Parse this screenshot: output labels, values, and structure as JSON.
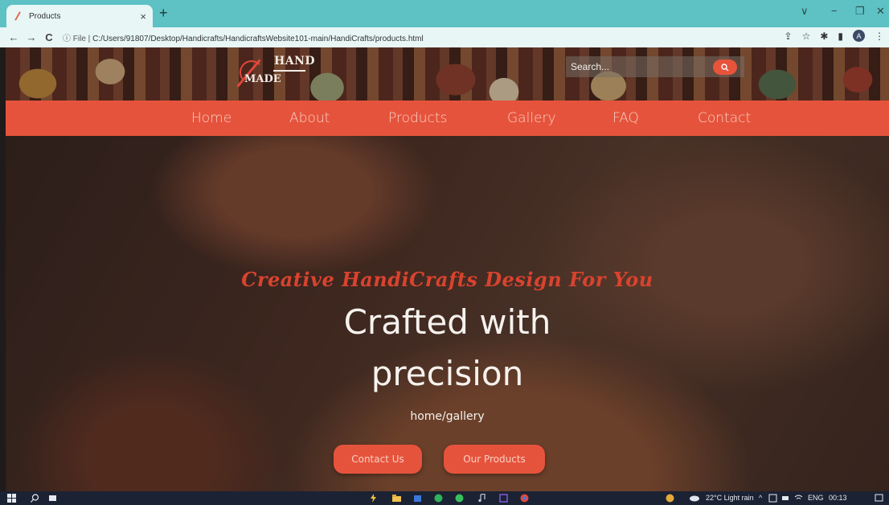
{
  "browser": {
    "tab_title": "Products",
    "tab_close": "×",
    "new_tab": "+",
    "window_controls": {
      "collapse": "∨",
      "minimize": "−",
      "restore": "❐",
      "close": "✕"
    },
    "nav": {
      "back": "←",
      "forward": "→",
      "reload": "C"
    },
    "url_label": "ⓘ File |",
    "url": "C:/Users/91807/Desktop/Handicrafts/HandicraftsWebsite101-main/HandiCrafts/products.html",
    "toolbar_icons": {
      "share": "⇪",
      "star": "☆",
      "extensions": "✱",
      "sidepanel": "▮",
      "profile": "A",
      "menu": "⋮"
    }
  },
  "site": {
    "logo": {
      "line1": "HAND",
      "line2": "MADE"
    },
    "search": {
      "placeholder": "Search..."
    },
    "nav": [
      "Home",
      "About",
      "Products",
      "Gallery",
      "FAQ",
      "Contact"
    ]
  },
  "hero": {
    "tagline": "Creative HandiCrafts Design For You",
    "headline_line1": "Crafted with",
    "headline_line2": "precision",
    "breadcrumb": "home/gallery",
    "buttons": {
      "contact": "Contact Us",
      "products": "Our Products"
    }
  },
  "taskbar": {
    "weather": "22°C Light rain",
    "tray_arrow": "^",
    "language": "ENG",
    "time": "00:13"
  },
  "colors": {
    "accent": "#e6533c",
    "tab_bar": "#5ec1c4",
    "address_bar": "#e8f6f6",
    "taskbar": "#1b2233"
  }
}
